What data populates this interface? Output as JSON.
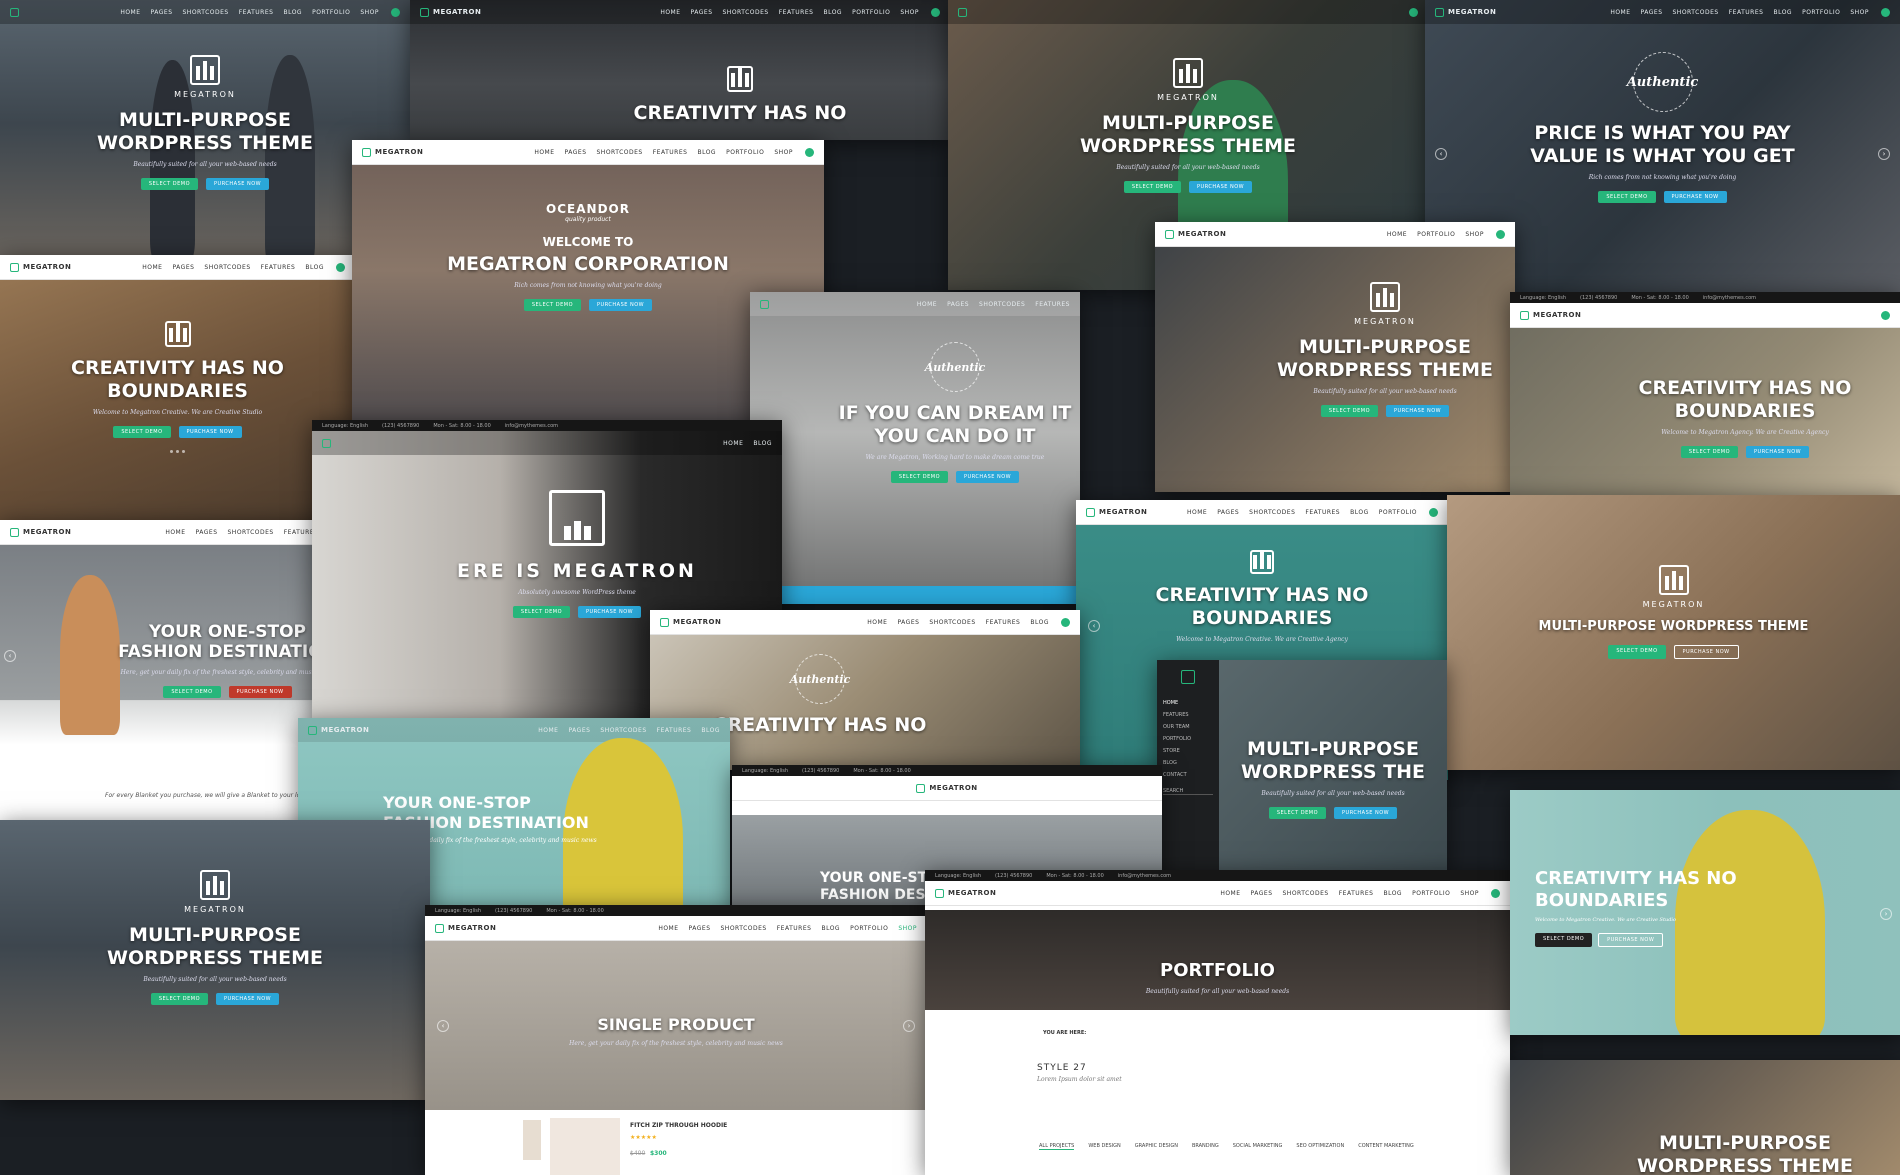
{
  "brand": "MEGATRON",
  "colors": {
    "accent_green": "#26b67b",
    "accent_blue": "#2aa7d8",
    "teal": "#2f7c78"
  },
  "nav_links": [
    "HOME",
    "PAGES",
    "SHORTCODES",
    "FEATURES",
    "BLOG",
    "PORTFOLIO",
    "SHOP"
  ],
  "top_bar": {
    "language": "Language: English",
    "phone": "(123) 4567890",
    "hours": "Mon - Sat: 8.00 - 18.00",
    "email": "info@mythemes.com"
  },
  "buttons": {
    "select_demo": "SELECT DEMO",
    "purchase": "PURCHASE NOW"
  },
  "tagline_default": "Beautifully suited for all your web-based needs",
  "shots": {
    "s1": {
      "title_1": "MULTI-PURPOSE",
      "title_2": "WORDPRESS THEME",
      "tag": "Beautifully suited for all your web-based needs"
    },
    "s2": {
      "title": "CREATIVITY HAS NO"
    },
    "s3": {
      "title_1": "MULTI-PURPOSE",
      "title_2": "WORDPRESS THEME",
      "tag": "Beautifully suited for all your web-based needs"
    },
    "s4": {
      "badge": "Authentic",
      "title_1": "PRICE IS WHAT YOU PAY",
      "title_2": "VALUE IS WHAT YOU GET",
      "tag": "Rich comes from not knowing what you're doing"
    },
    "s5": {
      "title_1": "CREATIVITY HAS NO",
      "title_2": "BOUNDARIES",
      "tag": "Welcome to Megatron Creative. We are Creative Studio"
    },
    "s6": {
      "logo_text": "OCEANDOR",
      "logo_sub": "quality product",
      "title_1": "WELCOME TO",
      "title_2": "MEGATRON CORPORATION",
      "tag": "Rich comes from not knowing what you're doing"
    },
    "s7": {
      "badge": "Authentic",
      "title_1": "IF YOU CAN DREAM IT",
      "title_2": "YOU CAN DO IT",
      "tag": "We are Megatron, Working hard to make dream come true"
    },
    "s8": {
      "title_1": "MULTI-PURPOSE",
      "title_2": "WORDPRESS THEME",
      "tag": "Beautifully suited for all your web-based needs"
    },
    "s9": {
      "title_1": "CREATIVITY HAS NO",
      "title_2": "BOUNDARIES",
      "tag": "Welcome to Megatron Agency. We are Creative Agency"
    },
    "s10": {
      "title_1": "YOUR ONE-STOP",
      "title_2": "FASHION DESTINATION",
      "tag": "Here, get your daily fix of the freshest style, celebrity and music news",
      "footer": "For every Blanket you purchase, we will give a Blanket to your local Homeless"
    },
    "s11": {
      "title": "ERE IS MEGATRON",
      "tag": "Absolutely awesome WordPress theme"
    },
    "s12": {
      "title_1": "CREATIVITY HAS NO",
      "title_2": "BOUNDARIES",
      "tag": "Welcome to Megatron Creative. We are Creative Agency"
    },
    "s13": {
      "title": "MULTI-PURPOSE WORDPRESS THEME",
      "brand": "MEGATRON"
    },
    "s14": {
      "badge": "Authentic",
      "title": "CREATIVITY HAS NO"
    },
    "s15": {
      "title_1": "MULTI-PURPOSE",
      "title_2": "WORDPRESS THE",
      "tag": "Beautifully suited for all your web-based needs",
      "menu": [
        "HOME",
        "FEATURES",
        "OUR TEAM",
        "PORTFOLIO",
        "STORE",
        "BLOG",
        "CONTACT"
      ],
      "search": "SEARCH"
    },
    "s16": {
      "title_1": "YOUR ONE-STOP",
      "title_2": "FASHION DESTINATION",
      "tag": "Here, get your daily fix of the freshest style, celebrity and music news"
    },
    "s17": {
      "title_1": "YOUR ONE-ST",
      "title_2": "FASHION DEST"
    },
    "s18": {
      "title_1": "MULTI-PURPOSE",
      "title_2": "WORDPRESS THEME",
      "tag": "Beautifully suited for all your web-based needs"
    },
    "s19": {
      "title": "SINGLE PRODUCT",
      "tag": "Here, get your daily fix of the freshest style, celebrity and music news",
      "product_name": "FITCH ZIP THROUGH HOODIE",
      "old_price": "$400",
      "price": "$300"
    },
    "s20": {
      "title": "PORTFOLIO",
      "tag": "Beautifully suited for all your web-based needs",
      "crumb": "YOU ARE HERE:",
      "style_title": "STYLE 27",
      "style_sub": "Lorem Ipsum dolor sit amet",
      "filters": [
        "ALL PROJECTS",
        "WEB DESIGN",
        "GRAPHIC DESIGN",
        "BRANDING",
        "SOCIAL MARKETING",
        "SEO OPTIMIZATION",
        "CONTENT MARKETING"
      ]
    },
    "s21": {
      "title_1": "CREATIVITY HAS NO",
      "title_2": "BOUNDARIES",
      "tag": "Welcome to Megatron Creative. We are Creative Studio"
    },
    "s22": {
      "title_1": "MULTI-PURPOSE",
      "title_2": "WORDPRESS THEME"
    }
  }
}
